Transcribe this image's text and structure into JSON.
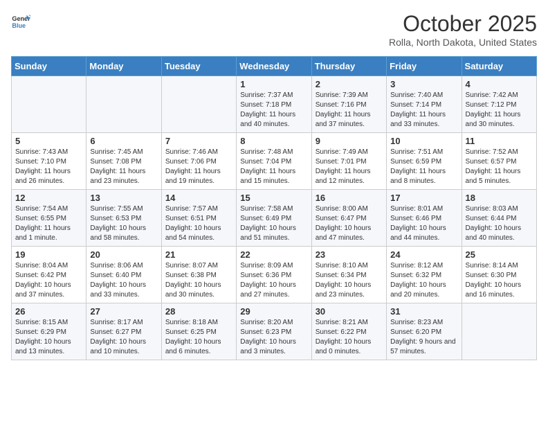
{
  "logo": {
    "general": "General",
    "blue": "Blue"
  },
  "header": {
    "month": "October 2025",
    "location": "Rolla, North Dakota, United States"
  },
  "weekdays": [
    "Sunday",
    "Monday",
    "Tuesday",
    "Wednesday",
    "Thursday",
    "Friday",
    "Saturday"
  ],
  "weeks": [
    [
      {
        "day": "",
        "sunrise": "",
        "sunset": "",
        "daylight": ""
      },
      {
        "day": "",
        "sunrise": "",
        "sunset": "",
        "daylight": ""
      },
      {
        "day": "",
        "sunrise": "",
        "sunset": "",
        "daylight": ""
      },
      {
        "day": "1",
        "sunrise": "Sunrise: 7:37 AM",
        "sunset": "Sunset: 7:18 PM",
        "daylight": "Daylight: 11 hours and 40 minutes."
      },
      {
        "day": "2",
        "sunrise": "Sunrise: 7:39 AM",
        "sunset": "Sunset: 7:16 PM",
        "daylight": "Daylight: 11 hours and 37 minutes."
      },
      {
        "day": "3",
        "sunrise": "Sunrise: 7:40 AM",
        "sunset": "Sunset: 7:14 PM",
        "daylight": "Daylight: 11 hours and 33 minutes."
      },
      {
        "day": "4",
        "sunrise": "Sunrise: 7:42 AM",
        "sunset": "Sunset: 7:12 PM",
        "daylight": "Daylight: 11 hours and 30 minutes."
      }
    ],
    [
      {
        "day": "5",
        "sunrise": "Sunrise: 7:43 AM",
        "sunset": "Sunset: 7:10 PM",
        "daylight": "Daylight: 11 hours and 26 minutes."
      },
      {
        "day": "6",
        "sunrise": "Sunrise: 7:45 AM",
        "sunset": "Sunset: 7:08 PM",
        "daylight": "Daylight: 11 hours and 23 minutes."
      },
      {
        "day": "7",
        "sunrise": "Sunrise: 7:46 AM",
        "sunset": "Sunset: 7:06 PM",
        "daylight": "Daylight: 11 hours and 19 minutes."
      },
      {
        "day": "8",
        "sunrise": "Sunrise: 7:48 AM",
        "sunset": "Sunset: 7:04 PM",
        "daylight": "Daylight: 11 hours and 15 minutes."
      },
      {
        "day": "9",
        "sunrise": "Sunrise: 7:49 AM",
        "sunset": "Sunset: 7:01 PM",
        "daylight": "Daylight: 11 hours and 12 minutes."
      },
      {
        "day": "10",
        "sunrise": "Sunrise: 7:51 AM",
        "sunset": "Sunset: 6:59 PM",
        "daylight": "Daylight: 11 hours and 8 minutes."
      },
      {
        "day": "11",
        "sunrise": "Sunrise: 7:52 AM",
        "sunset": "Sunset: 6:57 PM",
        "daylight": "Daylight: 11 hours and 5 minutes."
      }
    ],
    [
      {
        "day": "12",
        "sunrise": "Sunrise: 7:54 AM",
        "sunset": "Sunset: 6:55 PM",
        "daylight": "Daylight: 11 hours and 1 minute."
      },
      {
        "day": "13",
        "sunrise": "Sunrise: 7:55 AM",
        "sunset": "Sunset: 6:53 PM",
        "daylight": "Daylight: 10 hours and 58 minutes."
      },
      {
        "day": "14",
        "sunrise": "Sunrise: 7:57 AM",
        "sunset": "Sunset: 6:51 PM",
        "daylight": "Daylight: 10 hours and 54 minutes."
      },
      {
        "day": "15",
        "sunrise": "Sunrise: 7:58 AM",
        "sunset": "Sunset: 6:49 PM",
        "daylight": "Daylight: 10 hours and 51 minutes."
      },
      {
        "day": "16",
        "sunrise": "Sunrise: 8:00 AM",
        "sunset": "Sunset: 6:47 PM",
        "daylight": "Daylight: 10 hours and 47 minutes."
      },
      {
        "day": "17",
        "sunrise": "Sunrise: 8:01 AM",
        "sunset": "Sunset: 6:46 PM",
        "daylight": "Daylight: 10 hours and 44 minutes."
      },
      {
        "day": "18",
        "sunrise": "Sunrise: 8:03 AM",
        "sunset": "Sunset: 6:44 PM",
        "daylight": "Daylight: 10 hours and 40 minutes."
      }
    ],
    [
      {
        "day": "19",
        "sunrise": "Sunrise: 8:04 AM",
        "sunset": "Sunset: 6:42 PM",
        "daylight": "Daylight: 10 hours and 37 minutes."
      },
      {
        "day": "20",
        "sunrise": "Sunrise: 8:06 AM",
        "sunset": "Sunset: 6:40 PM",
        "daylight": "Daylight: 10 hours and 33 minutes."
      },
      {
        "day": "21",
        "sunrise": "Sunrise: 8:07 AM",
        "sunset": "Sunset: 6:38 PM",
        "daylight": "Daylight: 10 hours and 30 minutes."
      },
      {
        "day": "22",
        "sunrise": "Sunrise: 8:09 AM",
        "sunset": "Sunset: 6:36 PM",
        "daylight": "Daylight: 10 hours and 27 minutes."
      },
      {
        "day": "23",
        "sunrise": "Sunrise: 8:10 AM",
        "sunset": "Sunset: 6:34 PM",
        "daylight": "Daylight: 10 hours and 23 minutes."
      },
      {
        "day": "24",
        "sunrise": "Sunrise: 8:12 AM",
        "sunset": "Sunset: 6:32 PM",
        "daylight": "Daylight: 10 hours and 20 minutes."
      },
      {
        "day": "25",
        "sunrise": "Sunrise: 8:14 AM",
        "sunset": "Sunset: 6:30 PM",
        "daylight": "Daylight: 10 hours and 16 minutes."
      }
    ],
    [
      {
        "day": "26",
        "sunrise": "Sunrise: 8:15 AM",
        "sunset": "Sunset: 6:29 PM",
        "daylight": "Daylight: 10 hours and 13 minutes."
      },
      {
        "day": "27",
        "sunrise": "Sunrise: 8:17 AM",
        "sunset": "Sunset: 6:27 PM",
        "daylight": "Daylight: 10 hours and 10 minutes."
      },
      {
        "day": "28",
        "sunrise": "Sunrise: 8:18 AM",
        "sunset": "Sunset: 6:25 PM",
        "daylight": "Daylight: 10 hours and 6 minutes."
      },
      {
        "day": "29",
        "sunrise": "Sunrise: 8:20 AM",
        "sunset": "Sunset: 6:23 PM",
        "daylight": "Daylight: 10 hours and 3 minutes."
      },
      {
        "day": "30",
        "sunrise": "Sunrise: 8:21 AM",
        "sunset": "Sunset: 6:22 PM",
        "daylight": "Daylight: 10 hours and 0 minutes."
      },
      {
        "day": "31",
        "sunrise": "Sunrise: 8:23 AM",
        "sunset": "Sunset: 6:20 PM",
        "daylight": "Daylight: 9 hours and 57 minutes."
      },
      {
        "day": "",
        "sunrise": "",
        "sunset": "",
        "daylight": ""
      }
    ]
  ]
}
